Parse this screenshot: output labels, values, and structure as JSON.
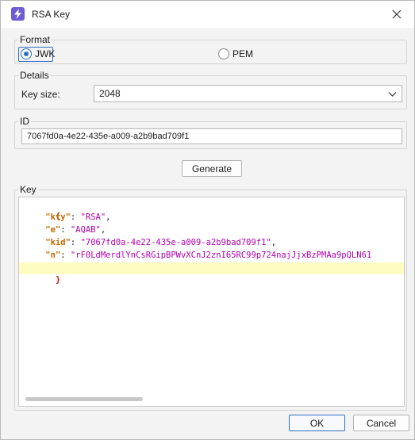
{
  "window": {
    "title": "RSA Key",
    "icon": "lightning-bolt-icon",
    "accent_color": "#6f5bd6",
    "close_icon": "close-icon"
  },
  "format": {
    "legend": "Format",
    "options": [
      {
        "label": "JWK",
        "selected": true
      },
      {
        "label": "PEM",
        "selected": false
      }
    ]
  },
  "details": {
    "legend": "Details",
    "key_size_label": "Key size:",
    "key_size_value": "2048"
  },
  "id_group": {
    "legend": "ID",
    "value": "7067fd0a-4e22-435e-a009-a2b9bad709f1"
  },
  "generate_label": "Generate",
  "key_group": {
    "legend": "Key",
    "open_brace": "{",
    "close_brace": "}",
    "entries": [
      {
        "key": "\"kty\"",
        "value": "\"RSA\"",
        "trail": ","
      },
      {
        "key": "\"e\"",
        "value": "\"AQAB\"",
        "trail": ","
      },
      {
        "key": "\"kid\"",
        "value": "\"7067fd0a-4e22-435e-a009-a2b9bad709f1\"",
        "trail": ","
      },
      {
        "key": "\"n\"",
        "value": "\"rF0LdMerdlYnCsRGipBPWvXCnJ2znI65RC99p724najJjxBzPMAa9pQLN61",
        "trail": ""
      }
    ]
  },
  "footer": {
    "ok_label": "OK",
    "cancel_label": "Cancel"
  }
}
